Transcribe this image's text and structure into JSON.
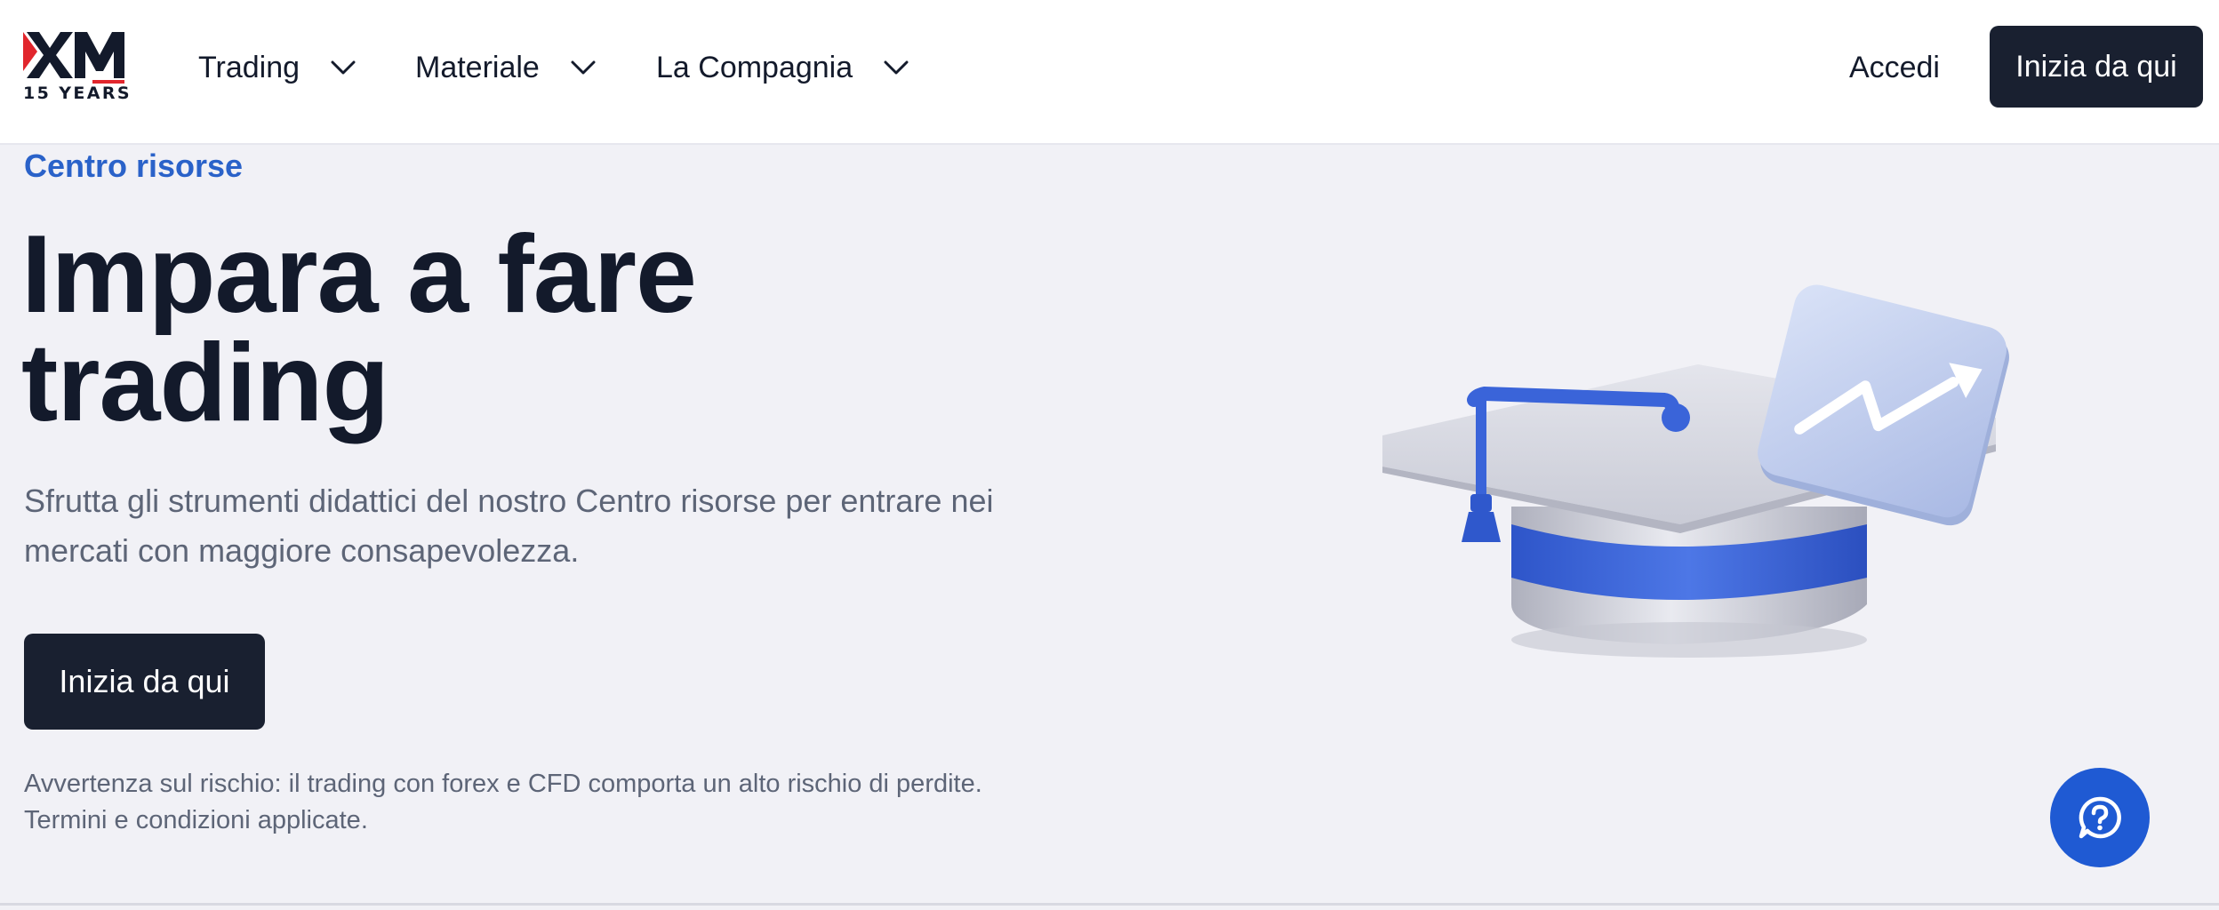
{
  "brand": {
    "logo_text": "XM",
    "years": "15 YEARS",
    "accent_red": "#e1262d"
  },
  "nav": {
    "items": [
      {
        "label": "Trading",
        "icon": "chevron-down-icon"
      },
      {
        "label": "Materiale",
        "icon": "chevron-down-icon"
      },
      {
        "label": "La Compagnia",
        "icon": "chevron-down-icon"
      }
    ],
    "login_label": "Accedi",
    "cta_label": "Inizia da qui"
  },
  "hero": {
    "eyebrow": "Centro risorse",
    "title_line1": "Impara a fare",
    "title_line2": "trading",
    "subtitle": "Sfrutta gli strumenti didattici del nostro Centro risorse per entrare nei mercati con maggiore consapevolezza.",
    "cta_label": "Inizia da qui",
    "risk_line1": "Avvertenza sul rischio: il trading con forex e CFD comporta un alto rischio di perdite.",
    "risk_line2": "Termini e condizioni applicate.",
    "illustration": "graduation-cap-with-chart-illustration"
  },
  "support": {
    "icon": "help-chat-icon"
  },
  "colors": {
    "primary_dark": "#192030",
    "link_blue": "#2a62c9",
    "help_blue": "#1f5ad3",
    "background": "#f1f1f6"
  }
}
